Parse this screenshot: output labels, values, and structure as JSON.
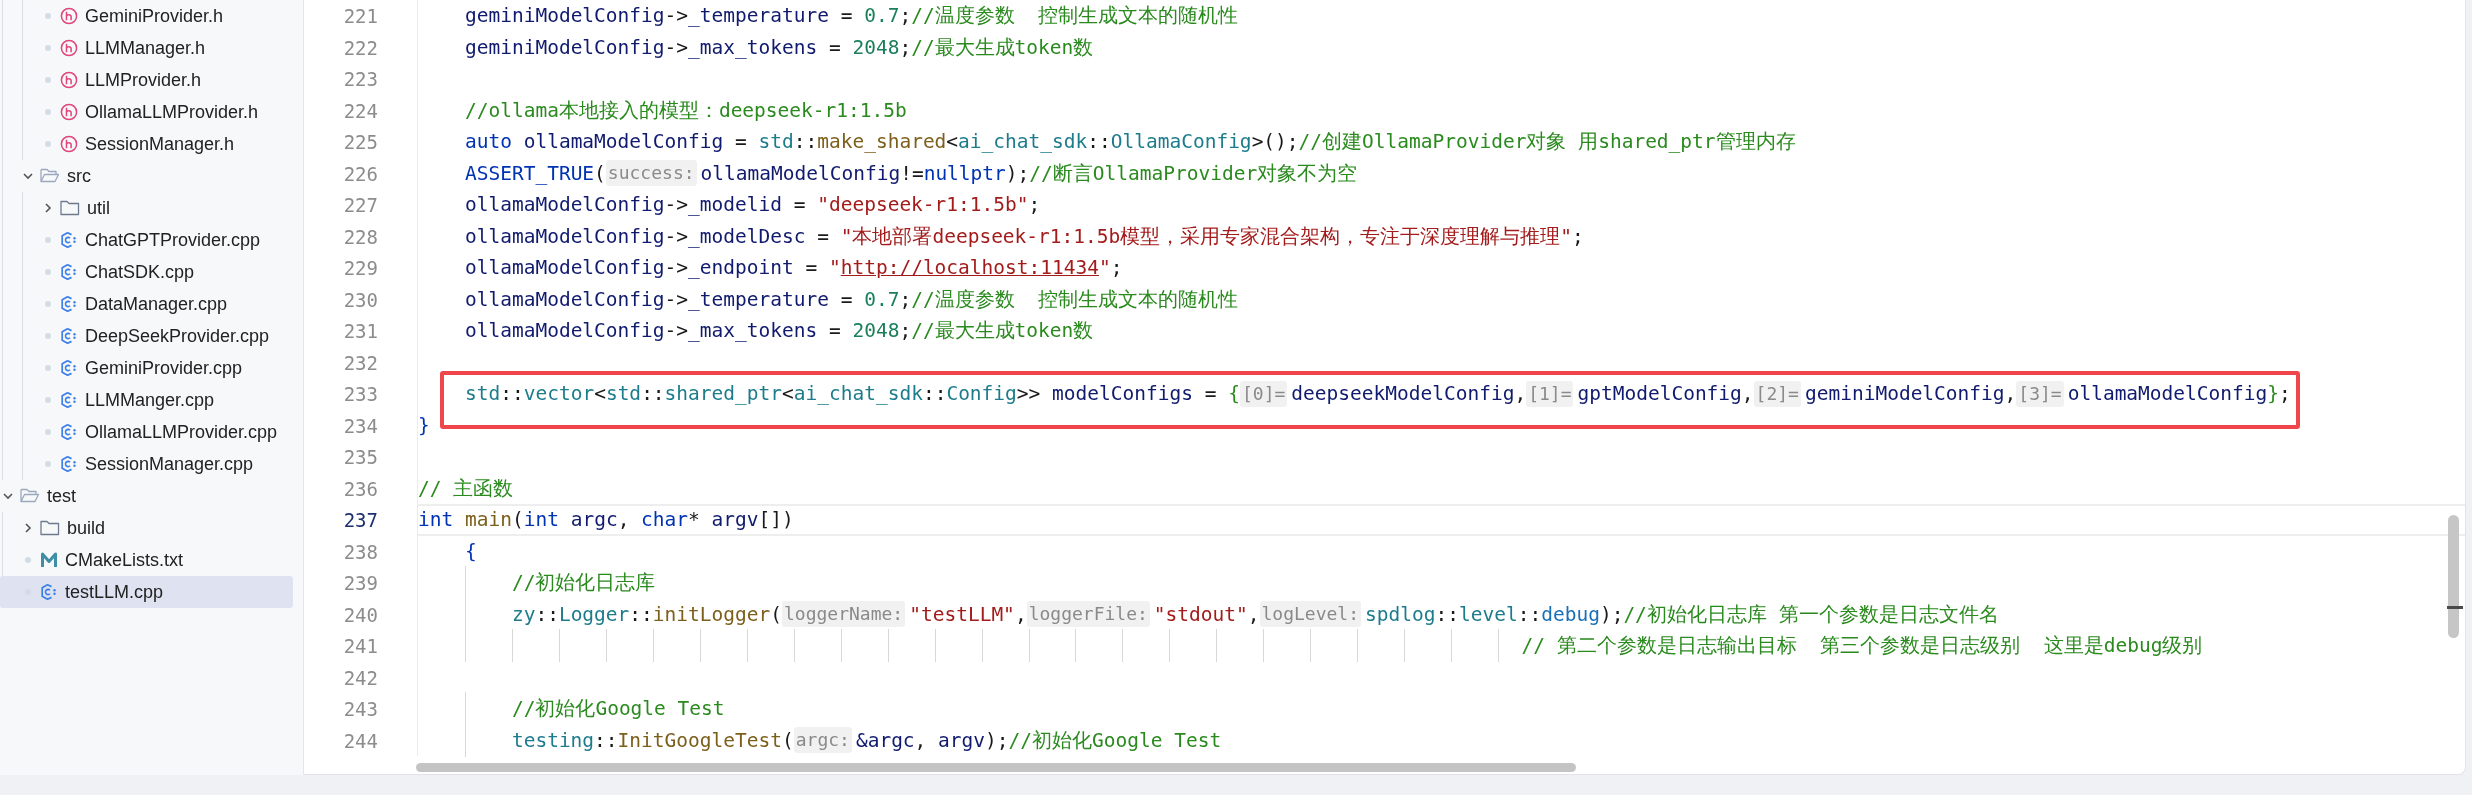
{
  "sidebar": {
    "tree": [
      {
        "children": [
          {
            "children": [
              {
                "label": "GeminiProvider.h",
                "kind": "header",
                "selected": false
              },
              {
                "label": "LLMManager.h",
                "kind": "header",
                "selected": false
              },
              {
                "label": "LLMProvider.h",
                "kind": "header",
                "selected": false
              },
              {
                "label": "OllamaLLMProvider.h",
                "kind": "header",
                "selected": false
              },
              {
                "label": "SessionManager.h",
                "kind": "header",
                "selected": false
              }
            ]
          },
          {
            "label": "src",
            "kind": "folder",
            "expanded": true,
            "selected": false,
            "children": [
              {
                "label": "util",
                "kind": "folder",
                "expanded": false,
                "selected": false
              },
              {
                "label": "ChatGPTProvider.cpp",
                "kind": "source",
                "selected": false
              },
              {
                "label": "ChatSDK.cpp",
                "kind": "source",
                "selected": false
              },
              {
                "label": "DataManager.cpp",
                "kind": "source",
                "selected": false
              },
              {
                "label": "DeepSeekProvider.cpp",
                "kind": "source",
                "selected": false
              },
              {
                "label": "GeminiProvider.cpp",
                "kind": "source",
                "selected": false
              },
              {
                "label": "LLMManger.cpp",
                "kind": "source",
                "selected": false
              },
              {
                "label": "OllamaLLMProvider.cpp",
                "kind": "source",
                "selected": false
              },
              {
                "label": "SessionManager.cpp",
                "kind": "source",
                "selected": false
              }
            ]
          }
        ]
      },
      {
        "label": "test",
        "kind": "folder",
        "expanded": true,
        "selected": false,
        "children": [
          {
            "label": "build",
            "kind": "folder",
            "expanded": false,
            "selected": false
          },
          {
            "label": "CMakeLists.txt",
            "kind": "cmake",
            "selected": false
          },
          {
            "label": "testLLM.cpp",
            "kind": "source",
            "selected": true
          }
        ]
      }
    ]
  },
  "editor": {
    "lines": [
      {
        "number": "221",
        "current": false,
        "boxed": false,
        "tokens": [
          {
            "kind": "var",
            "text": "    geminiModelConfig"
          },
          {
            "kind": "punct",
            "text": "->"
          },
          {
            "kind": "var",
            "text": "_temperature"
          },
          {
            "kind": "punct",
            "text": " = "
          },
          {
            "kind": "number",
            "text": "0.7"
          },
          {
            "kind": "punct",
            "text": ";"
          },
          {
            "kind": "comment",
            "text": "//温度参数  控制生成文本的随机性"
          }
        ]
      },
      {
        "number": "222",
        "current": false,
        "boxed": false,
        "tokens": [
          {
            "kind": "var",
            "text": "    geminiModelConfig"
          },
          {
            "kind": "punct",
            "text": "->"
          },
          {
            "kind": "var",
            "text": "_max_tokens"
          },
          {
            "kind": "punct",
            "text": " = "
          },
          {
            "kind": "number",
            "text": "2048"
          },
          {
            "kind": "punct",
            "text": ";"
          },
          {
            "kind": "comment",
            "text": "//最大生成token数"
          }
        ]
      },
      {
        "number": "223",
        "current": false,
        "boxed": false
      },
      {
        "number": "224",
        "current": false,
        "boxed": false,
        "tokens": [
          {
            "kind": "comment",
            "text": "    //ollama本地接入的模型：deepseek-r1:1.5b"
          }
        ]
      },
      {
        "number": "225",
        "current": false,
        "boxed": false,
        "tokens": [
          {
            "kind": "keyword",
            "text": "    auto "
          },
          {
            "kind": "var",
            "text": "ollamaModelConfig"
          },
          {
            "kind": "punct",
            "text": " = "
          },
          {
            "kind": "type",
            "text": "std"
          },
          {
            "kind": "punct",
            "text": "::"
          },
          {
            "kind": "func",
            "text": "make_shared"
          },
          {
            "kind": "punct",
            "text": "<"
          },
          {
            "kind": "type",
            "text": "ai_chat_sdk"
          },
          {
            "kind": "punct",
            "text": "::"
          },
          {
            "kind": "type",
            "text": "OllamaConfig"
          },
          {
            "kind": "punct",
            "text": ">();"
          },
          {
            "kind": "comment",
            "text": "//创建OllamaProvider对象 用shared_ptr管理内存"
          }
        ]
      },
      {
        "number": "226",
        "current": false,
        "boxed": false,
        "tokens": [
          {
            "kind": "keyword",
            "text": "    ASSERT_TRUE"
          },
          {
            "kind": "punct",
            "text": "("
          },
          {
            "kind": "hint",
            "text": "success:"
          },
          {
            "kind": "var",
            "text": "ollamaModelConfig"
          },
          {
            "kind": "punct",
            "text": "!="
          },
          {
            "kind": "keyword",
            "text": "nullptr"
          },
          {
            "kind": "punct",
            "text": ");"
          },
          {
            "kind": "comment",
            "text": "//断言OllamaProvider对象不为空"
          }
        ]
      },
      {
        "number": "227",
        "current": false,
        "boxed": false,
        "tokens": [
          {
            "kind": "var",
            "text": "    ollamaModelConfig"
          },
          {
            "kind": "punct",
            "text": "->"
          },
          {
            "kind": "var",
            "text": "_modelid"
          },
          {
            "kind": "punct",
            "text": " = "
          },
          {
            "kind": "string",
            "text": "\"deepseek-r1:1.5b\""
          },
          {
            "kind": "punct",
            "text": ";"
          }
        ]
      },
      {
        "number": "228",
        "current": false,
        "boxed": false,
        "tokens": [
          {
            "kind": "var",
            "text": "    ollamaModelConfig"
          },
          {
            "kind": "punct",
            "text": "->"
          },
          {
            "kind": "var",
            "text": "_modelDesc"
          },
          {
            "kind": "punct",
            "text": " = "
          },
          {
            "kind": "string",
            "text": "\"本地部署deepseek-r1:1.5b模型，采用专家混合架构，专注于深度理解与推理\""
          },
          {
            "kind": "punct",
            "text": ";"
          }
        ]
      },
      {
        "number": "229",
        "current": false,
        "boxed": false,
        "tokens": [
          {
            "kind": "var",
            "text": "    ollamaModelConfig"
          },
          {
            "kind": "punct",
            "text": "->"
          },
          {
            "kind": "var",
            "text": "_endpoint"
          },
          {
            "kind": "punct",
            "text": " = "
          },
          {
            "kind": "string",
            "text": "\""
          },
          {
            "kind": "url",
            "text": "http://localhost:11434"
          },
          {
            "kind": "string",
            "text": "\""
          },
          {
            "kind": "punct",
            "text": ";"
          }
        ]
      },
      {
        "number": "230",
        "current": false,
        "boxed": false,
        "tokens": [
          {
            "kind": "var",
            "text": "    ollamaModelConfig"
          },
          {
            "kind": "punct",
            "text": "->"
          },
          {
            "kind": "var",
            "text": "_temperature"
          },
          {
            "kind": "punct",
            "text": " = "
          },
          {
            "kind": "number",
            "text": "0.7"
          },
          {
            "kind": "punct",
            "text": ";"
          },
          {
            "kind": "comment",
            "text": "//温度参数  控制生成文本的随机性"
          }
        ]
      },
      {
        "number": "231",
        "current": false,
        "boxed": false,
        "tokens": [
          {
            "kind": "var",
            "text": "    ollamaModelConfig"
          },
          {
            "kind": "punct",
            "text": "->"
          },
          {
            "kind": "var",
            "text": "_max_tokens"
          },
          {
            "kind": "punct",
            "text": " = "
          },
          {
            "kind": "number",
            "text": "2048"
          },
          {
            "kind": "punct",
            "text": ";"
          },
          {
            "kind": "comment",
            "text": "//最大生成token数"
          }
        ]
      },
      {
        "number": "232",
        "current": false,
        "boxed": false
      },
      {
        "number": "233",
        "current": false,
        "boxed": true,
        "tokens": [
          {
            "kind": "type",
            "text": "    std"
          },
          {
            "kind": "punct",
            "text": "::"
          },
          {
            "kind": "type",
            "text": "vector"
          },
          {
            "kind": "punct",
            "text": "<"
          },
          {
            "kind": "type",
            "text": "std"
          },
          {
            "kind": "punct",
            "text": "::"
          },
          {
            "kind": "type",
            "text": "shared_ptr"
          },
          {
            "kind": "punct",
            "text": "<"
          },
          {
            "kind": "type",
            "text": "ai_chat_sdk"
          },
          {
            "kind": "punct",
            "text": "::"
          },
          {
            "kind": "type",
            "text": "Config"
          },
          {
            "kind": "punct",
            "text": ">> "
          },
          {
            "kind": "var",
            "text": "modelConfigs"
          },
          {
            "kind": "punct",
            "text": " = "
          },
          {
            "kind": "match",
            "text": "{"
          },
          {
            "kind": "hint",
            "text": "[0]="
          },
          {
            "kind": "var",
            "text": "deepseekModelConfig"
          },
          {
            "kind": "punct",
            "text": ","
          },
          {
            "kind": "hint",
            "text": "[1]="
          },
          {
            "kind": "var",
            "text": "gptModelConfig"
          },
          {
            "kind": "punct",
            "text": ","
          },
          {
            "kind": "hint",
            "text": "[2]="
          },
          {
            "kind": "var",
            "text": "geminiModelConfig"
          },
          {
            "kind": "punct",
            "text": ","
          },
          {
            "kind": "hint",
            "text": "[3]="
          },
          {
            "kind": "var",
            "text": "ollamaModelConfig"
          },
          {
            "kind": "match",
            "text": "}"
          },
          {
            "kind": "punct",
            "text": ";"
          }
        ]
      },
      {
        "number": "234",
        "current": false,
        "boxed": false,
        "tokens": [
          {
            "kind": "brace",
            "text": "}"
          }
        ]
      },
      {
        "number": "235",
        "current": false,
        "boxed": false
      },
      {
        "number": "236",
        "current": false,
        "boxed": false,
        "tokens": [
          {
            "kind": "comment",
            "text": "// 主函数"
          }
        ]
      },
      {
        "number": "237",
        "current": true,
        "boxed": false,
        "tokens": [
          {
            "kind": "keyword",
            "text": "int "
          },
          {
            "kind": "func",
            "text": "main"
          },
          {
            "kind": "punct",
            "text": "("
          },
          {
            "kind": "keyword",
            "text": "int "
          },
          {
            "kind": "var",
            "text": "argc"
          },
          {
            "kind": "punct",
            "text": ", "
          },
          {
            "kind": "keyword",
            "text": "char"
          },
          {
            "kind": "punct",
            "text": "* "
          },
          {
            "kind": "var",
            "text": "argv"
          },
          {
            "kind": "punct",
            "text": "[])"
          }
        ]
      },
      {
        "number": "238",
        "current": false,
        "boxed": false,
        "tokens": [
          {
            "kind": "brace",
            "text": "    {"
          }
        ]
      },
      {
        "number": "239",
        "current": false,
        "boxed": false,
        "tokens": [
          {
            "kind": "comment",
            "text": "        //初始化日志库"
          }
        ]
      },
      {
        "number": "240",
        "current": false,
        "boxed": false,
        "tokens": [
          {
            "kind": "type",
            "text": "        zy"
          },
          {
            "kind": "punct",
            "text": "::"
          },
          {
            "kind": "type",
            "text": "Logger"
          },
          {
            "kind": "punct",
            "text": "::"
          },
          {
            "kind": "func",
            "text": "initLogger"
          },
          {
            "kind": "punct",
            "text": "("
          },
          {
            "kind": "hint",
            "text": "loggerName:"
          },
          {
            "kind": "string",
            "text": "\"testLLM\""
          },
          {
            "kind": "punct",
            "text": ","
          },
          {
            "kind": "hint",
            "text": "loggerFile:"
          },
          {
            "kind": "string",
            "text": "\"stdout\""
          },
          {
            "kind": "punct",
            "text": ","
          },
          {
            "kind": "hint",
            "text": "logLevel:"
          },
          {
            "kind": "type",
            "text": "spdlog"
          },
          {
            "kind": "punct",
            "text": "::"
          },
          {
            "kind": "type",
            "text": "level"
          },
          {
            "kind": "punct",
            "text": "::"
          },
          {
            "kind": "enum",
            "text": "debug"
          },
          {
            "kind": "punct",
            "text": ");"
          },
          {
            "kind": "comment",
            "text": "//初始化日志库 第一个参数是日志文件名"
          }
        ]
      },
      {
        "number": "241",
        "current": false,
        "boxed": false,
        "tokens": [
          {
            "kind": "comment",
            "text": "                                                                                              // 第二个参数是日志输出目标  第三个参数是日志级别  这里是debug级别"
          }
        ]
      },
      {
        "number": "242",
        "current": false,
        "boxed": false
      },
      {
        "number": "243",
        "current": false,
        "boxed": false,
        "tokens": [
          {
            "kind": "comment",
            "text": "        //初始化Google Test"
          }
        ]
      },
      {
        "number": "244",
        "current": false,
        "boxed": false,
        "tokens": [
          {
            "kind": "type",
            "text": "        testing"
          },
          {
            "kind": "punct",
            "text": "::"
          },
          {
            "kind": "func",
            "text": "InitGoogleTest"
          },
          {
            "kind": "punct",
            "text": "("
          },
          {
            "kind": "hint",
            "text": "argc:"
          },
          {
            "kind": "var",
            "text": "&argc"
          },
          {
            "kind": "punct",
            "text": ", "
          },
          {
            "kind": "var",
            "text": "argv"
          },
          {
            "kind": "punct",
            "text": ");"
          },
          {
            "kind": "comment",
            "text": "//初始化Google Test"
          }
        ]
      }
    ]
  }
}
